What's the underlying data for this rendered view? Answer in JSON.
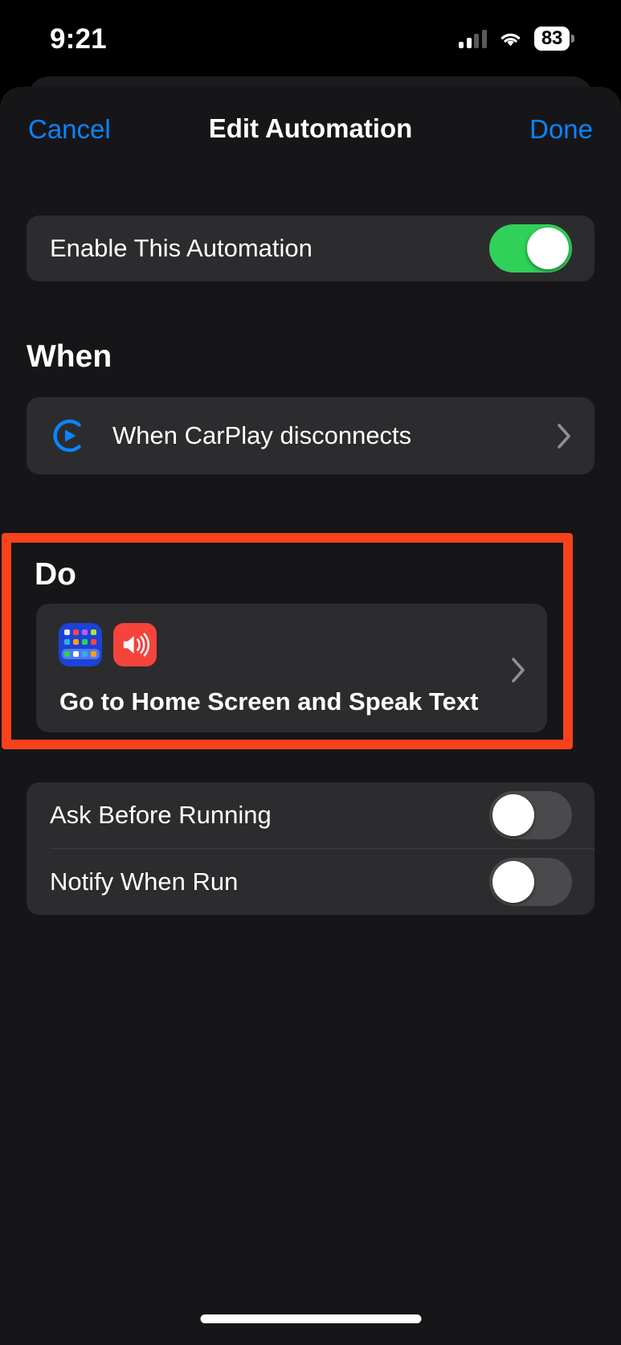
{
  "status_bar": {
    "time": "9:21",
    "cellular_icon": "cellular-bars-icon",
    "wifi_icon": "wifi-icon",
    "battery_percent": "83"
  },
  "nav": {
    "cancel_label": "Cancel",
    "title": "Edit Automation",
    "done_label": "Done",
    "accent_color": "#0a84ff"
  },
  "enable_row": {
    "label": "Enable This Automation",
    "toggle_state": "on",
    "toggle_on_color": "#2fd158"
  },
  "when_section": {
    "title": "When",
    "trigger_icon": "carplay-play-circle-icon",
    "trigger_label": "When CarPlay disconnects",
    "chevron_icon": "chevron-right-icon"
  },
  "do_section": {
    "title": "Do",
    "highlight_color": "#f9411c",
    "highlighted": true,
    "shortcut_label": "Go to Home Screen and Speak Text",
    "app_icons": [
      {
        "name": "home-screen-icon",
        "color": "#1b43d8"
      },
      {
        "name": "speak-text-speaker-icon",
        "color": "#f4443c"
      }
    ],
    "chevron_icon": "chevron-right-icon"
  },
  "options": [
    {
      "label": "Ask Before Running",
      "toggle_state": "off"
    },
    {
      "label": "Notify When Run",
      "toggle_state": "off"
    }
  ],
  "home_indicator": "home-indicator"
}
